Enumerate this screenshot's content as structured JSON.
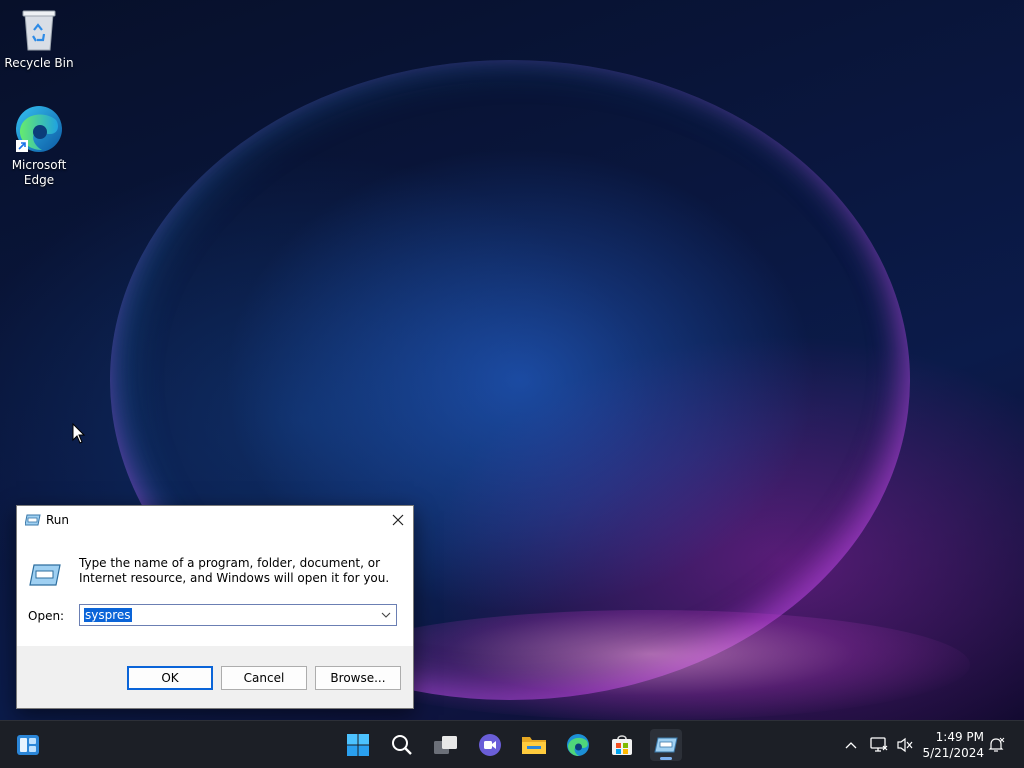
{
  "desktop": {
    "icons": [
      {
        "label": "Recycle Bin"
      },
      {
        "label": "Microsoft Edge"
      }
    ]
  },
  "run_dialog": {
    "title": "Run",
    "description": "Type the name of a program, folder, document, or Internet resource, and Windows will open it for you.",
    "open_label": "Open:",
    "input_value": "syspres",
    "ok_label": "OK",
    "cancel_label": "Cancel",
    "browse_label": "Browse..."
  },
  "taskbar": {
    "pinned": [
      "widgets-icon",
      "start-icon",
      "search-icon",
      "task-view-icon",
      "chat-icon",
      "file-explorer-icon",
      "edge-icon",
      "store-icon",
      "run-icon"
    ],
    "tray": [
      "chevron-up-icon",
      "network-icon",
      "volume-muted-icon",
      "notification-icon"
    ],
    "clock": {
      "time": "1:49 PM",
      "date": "5/21/2024"
    }
  },
  "colors": {
    "accent": "#0a64d8",
    "taskbar": "#1c1f26"
  }
}
